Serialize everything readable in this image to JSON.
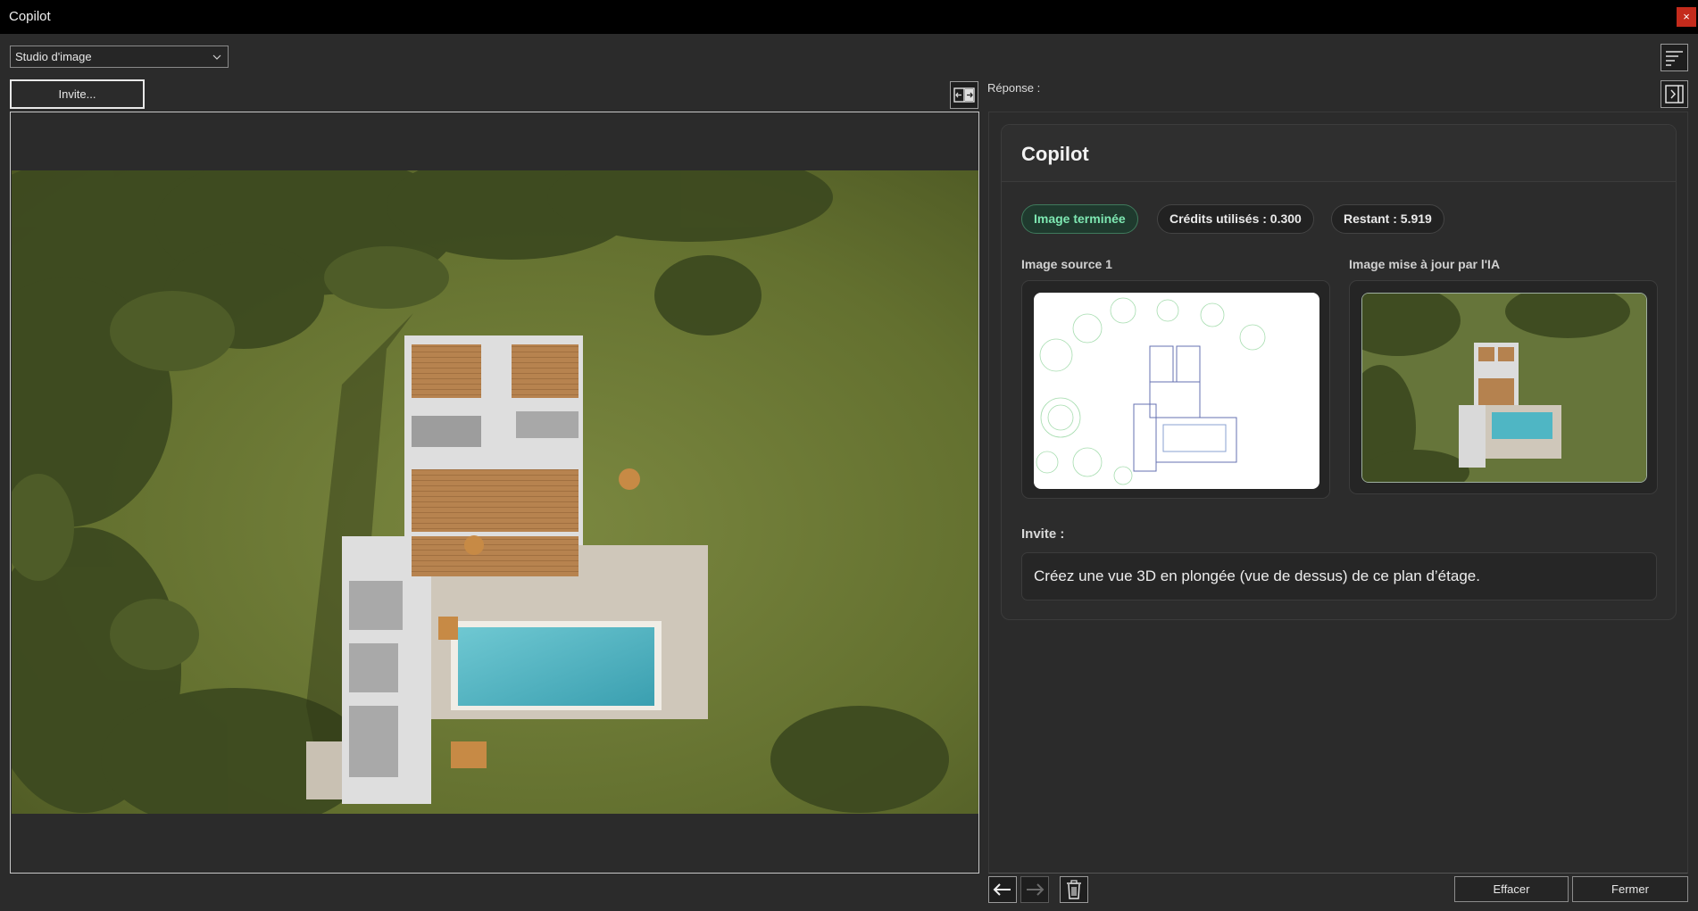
{
  "window": {
    "title": "Copilot",
    "close_glyph": "×"
  },
  "toolbar": {
    "mode_value": "Studio d'image",
    "invite_button": "Invite...",
    "swap_icon": "swap-panels-icon",
    "sort_icon": "sort-lines-icon",
    "collapse_icon": "collapse-right-icon"
  },
  "response": {
    "label": "Réponse :",
    "card_title": "Copilot",
    "badges": {
      "status": "Image terminée",
      "credits_used": "Crédits utilisés : 0.300",
      "remaining": "Restant : 5.919"
    },
    "source_label": "Image source 1",
    "updated_label": "Image mise à jour par l'IA",
    "invite_label": "Invite :",
    "invite_text": "Créez une vue 3D en plongée (vue de dessus) de ce plan d’étage."
  },
  "footer": {
    "back_icon": "arrow-left-icon",
    "forward_icon": "arrow-right-icon",
    "delete_icon": "trash-icon",
    "clear_button": "Effacer",
    "close_button": "Fermer"
  },
  "colors": {
    "background": "#2b2b2b",
    "titlebar": "#000000",
    "close": "#c42b1c",
    "status_green": "#7ee8b2",
    "grass": "#6d7a3a",
    "pool": "#4fb6c4",
    "wood": "#b5824f"
  }
}
